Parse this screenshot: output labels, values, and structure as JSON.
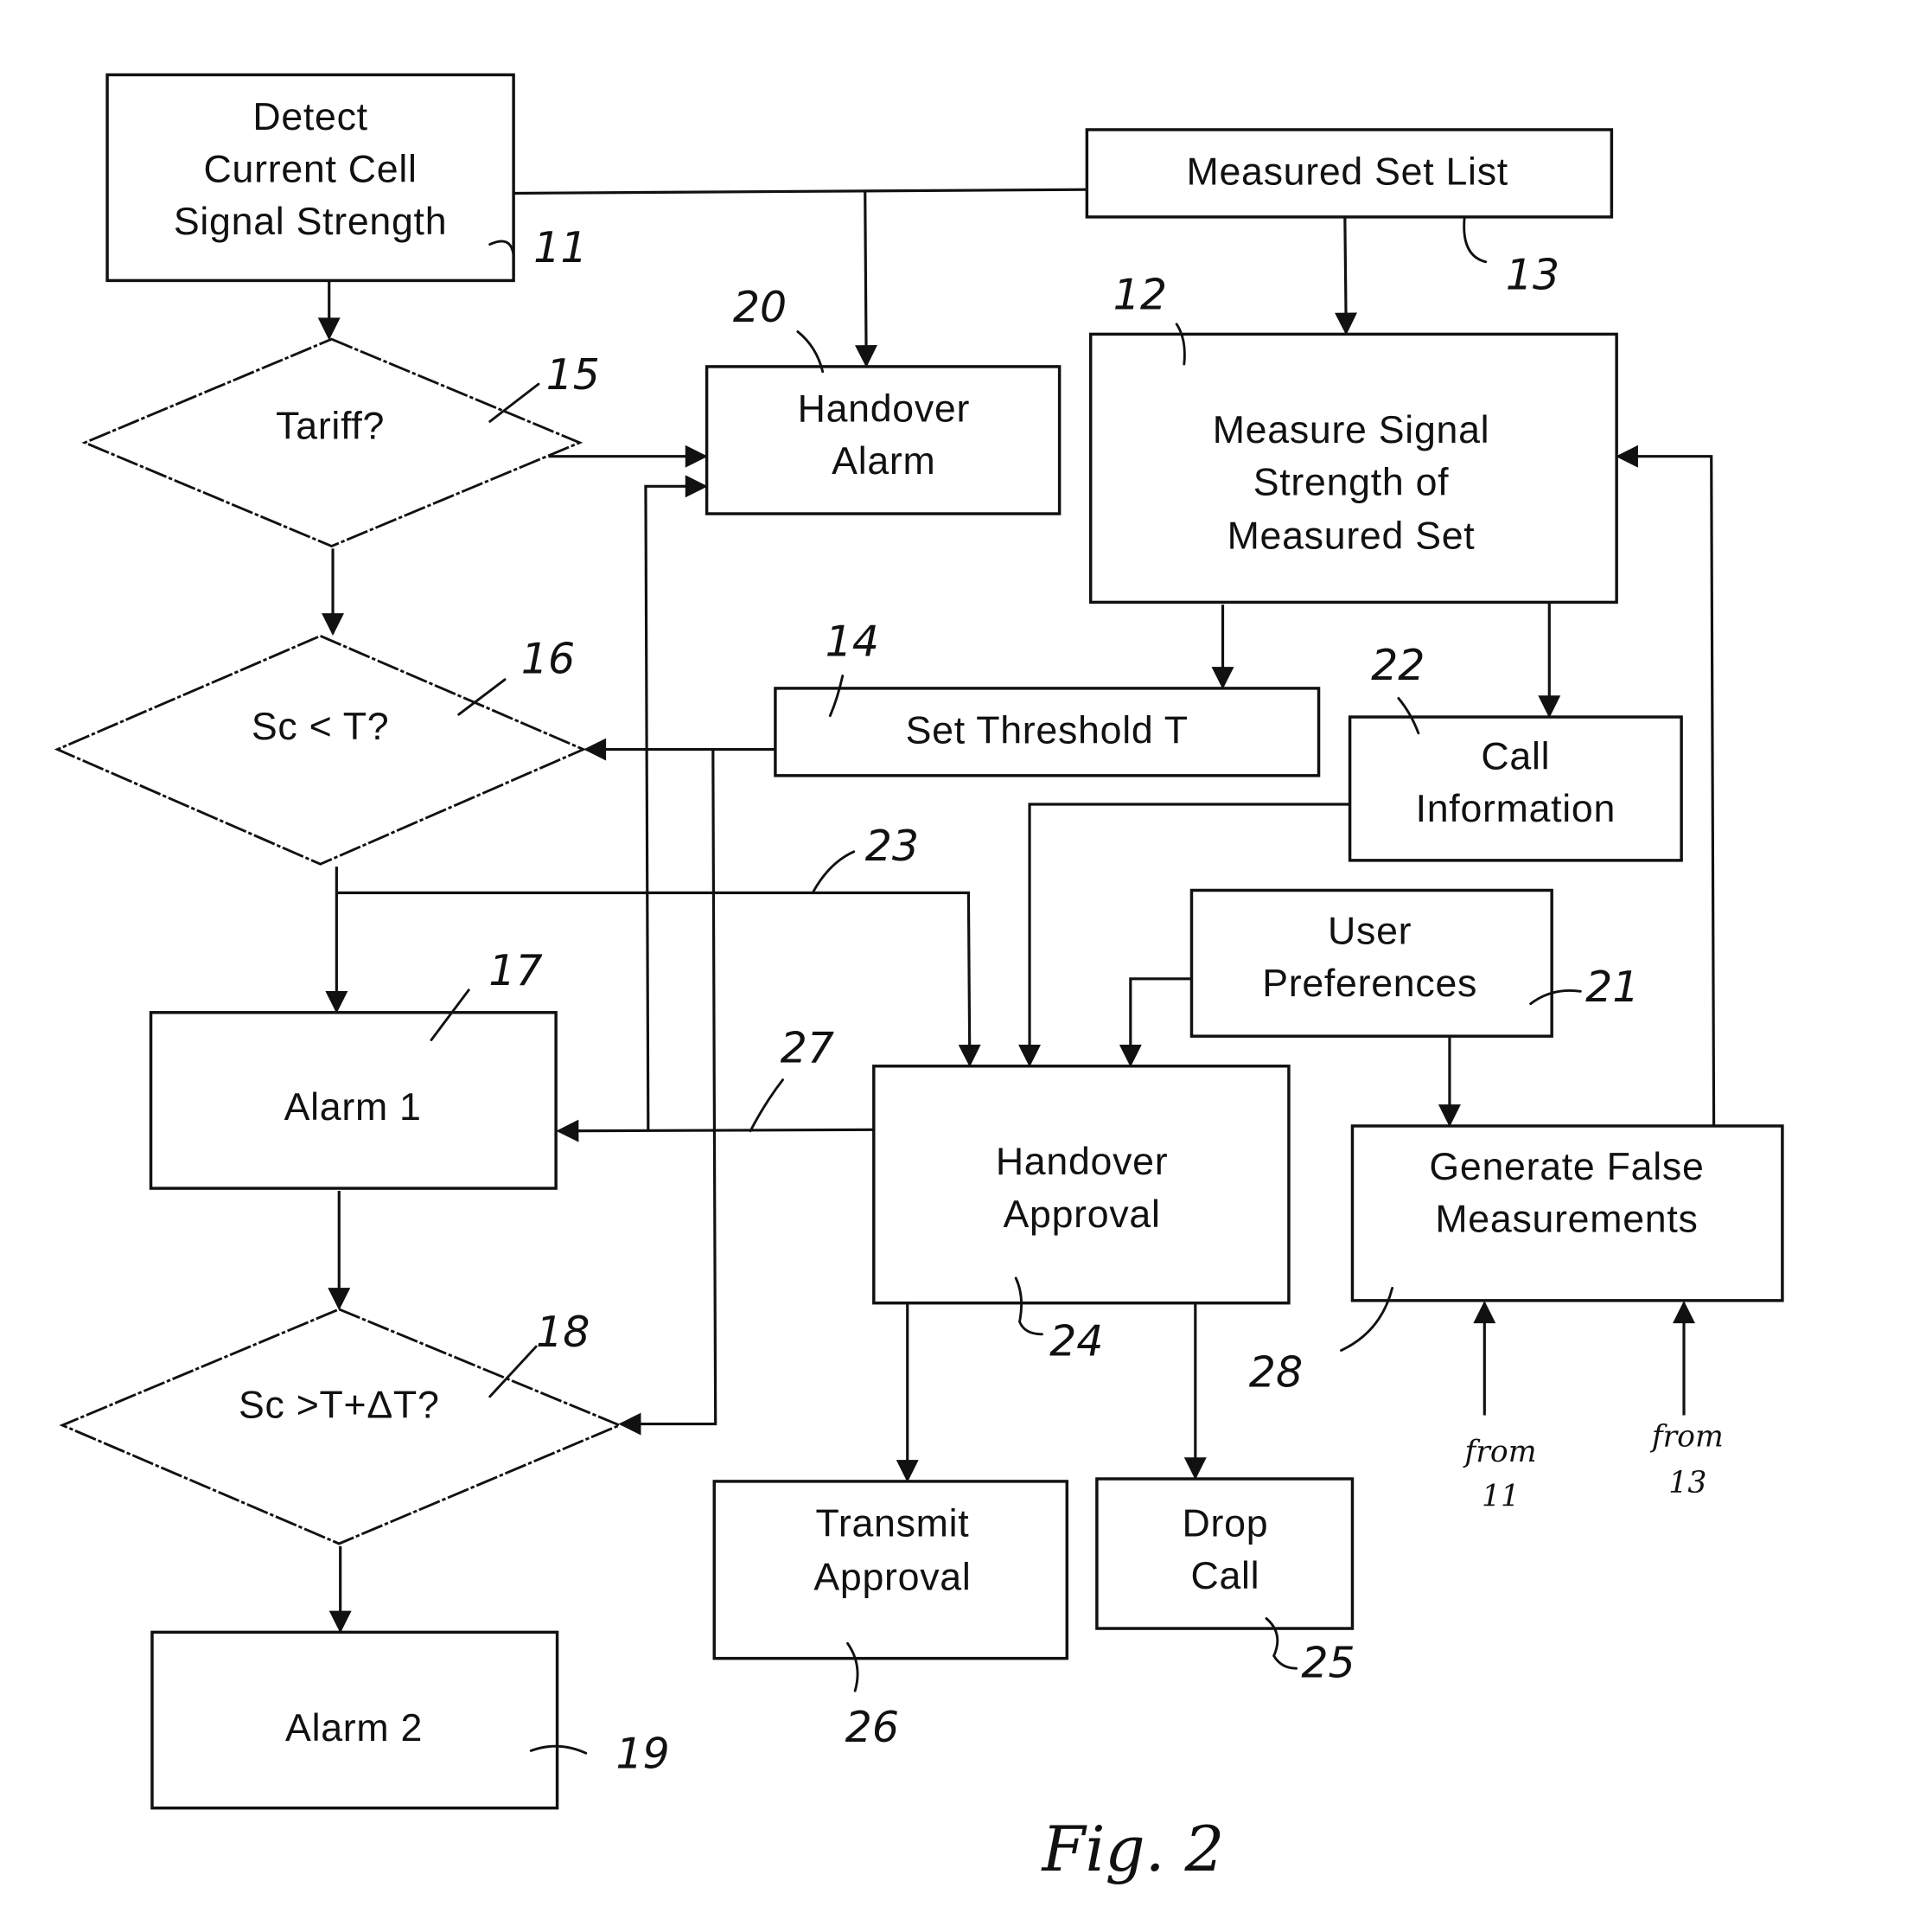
{
  "figure": {
    "caption": "Fig. 2"
  },
  "nodes": {
    "n11": {
      "ref": "11",
      "lines": [
        "Detect",
        "Current Cell",
        "Signal Strength"
      ]
    },
    "n13": {
      "ref": "13",
      "lines": [
        "Measured Set List"
      ]
    },
    "n20": {
      "ref": "20",
      "lines": [
        "Handover",
        "Alarm"
      ]
    },
    "n12": {
      "ref": "12",
      "lines": [
        "Measure Signal",
        "Strength of",
        "Measured Set"
      ]
    },
    "n15": {
      "ref": "15",
      "lines": [
        "Tariff?"
      ]
    },
    "n16": {
      "ref": "16",
      "lines": [
        "Sc < T?"
      ]
    },
    "n14": {
      "ref": "14",
      "lines": [
        "Set Threshold T"
      ]
    },
    "n22": {
      "ref": "22",
      "lines": [
        "Call",
        "Information"
      ]
    },
    "n21": {
      "ref": "21",
      "lines": [
        "User",
        "Preferences"
      ]
    },
    "n17": {
      "ref": "17",
      "lines": [
        "Alarm 1"
      ]
    },
    "n24": {
      "ref": "24",
      "lines": [
        "Handover",
        "Approval"
      ]
    },
    "n28": {
      "ref": "28",
      "lines": [
        "Generate False",
        "Measurements"
      ]
    },
    "n18": {
      "ref": "18",
      "lines": [
        "Sc >T+ΔT?"
      ]
    },
    "n26": {
      "ref": "26",
      "lines": [
        "Transmit",
        "Approval"
      ]
    },
    "n25": {
      "ref": "25",
      "lines": [
        "Drop",
        "Call"
      ]
    },
    "n19": {
      "ref": "19",
      "lines": [
        "Alarm 2"
      ]
    }
  },
  "connector_refs": {
    "c23": "23",
    "c27": "27"
  },
  "external_inputs": {
    "from11": [
      "from",
      "11"
    ],
    "from13": [
      "from",
      "13"
    ]
  }
}
